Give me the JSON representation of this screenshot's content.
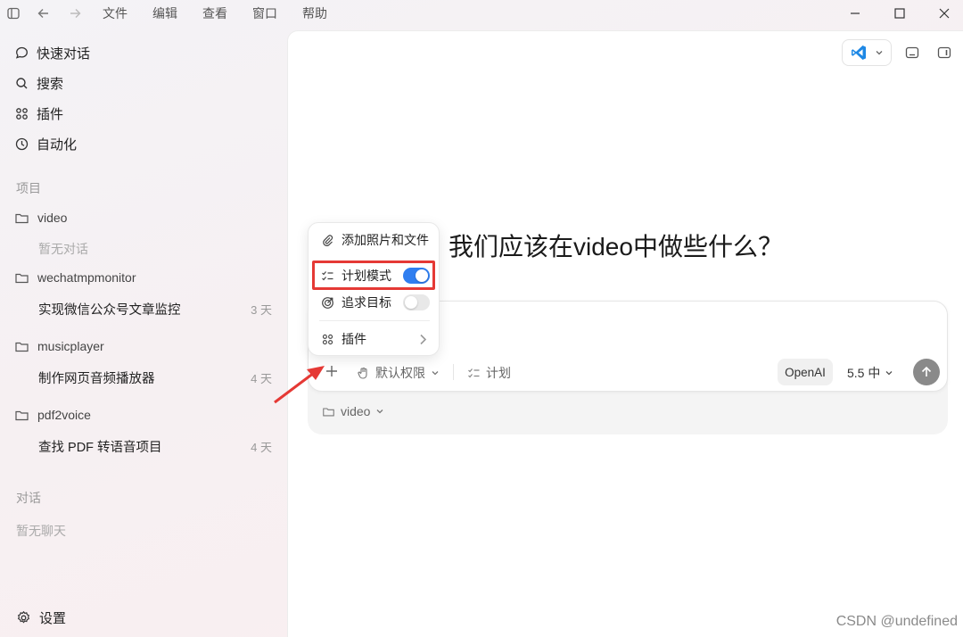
{
  "menubar": {
    "items": [
      "文件",
      "编辑",
      "查看",
      "窗口",
      "帮助"
    ]
  },
  "sidebar": {
    "nav": [
      {
        "label": "快速对话",
        "icon": "chat-bubble-icon"
      },
      {
        "label": "搜索",
        "icon": "search-icon"
      },
      {
        "label": "插件",
        "icon": "grid-icon"
      },
      {
        "label": "自动化",
        "icon": "clock-icon"
      }
    ],
    "projects_label": "项目",
    "projects": [
      {
        "name": "video",
        "empty": "暂无对话"
      },
      {
        "name": "wechatmpmonitor",
        "conversations": [
          {
            "title": "实现微信公众号文章监控",
            "age": "3 天"
          }
        ]
      },
      {
        "name": "musicplayer",
        "conversations": [
          {
            "title": "制作网页音频播放器",
            "age": "4 天"
          }
        ]
      },
      {
        "name": "pdf2voice",
        "conversations": [
          {
            "title": "查找 PDF 转语音项目",
            "age": "4 天"
          }
        ]
      }
    ],
    "chats_label": "对话",
    "chats_empty": "暂无聊天",
    "settings_label": "设置"
  },
  "main": {
    "headline": "我们应该在video中做些什么？",
    "composer": {
      "permission_label": "默认权限",
      "plan_label": "计划",
      "provider_label": "OpenAI",
      "model_label": "5.5 中",
      "folder_label": "video"
    }
  },
  "popup": {
    "items": [
      {
        "label": "添加照片和文件",
        "icon": "paperclip-icon"
      },
      {
        "label": "计划模式",
        "icon": "checklist-icon",
        "toggle": true
      },
      {
        "label": "追求目标",
        "icon": "target-icon",
        "toggle": false
      },
      {
        "label": "插件",
        "icon": "grid-icon"
      }
    ]
  },
  "colors": {
    "accent": "#2f7ef0",
    "highlight": "#e53935"
  },
  "watermark": "CSDN @undefined"
}
